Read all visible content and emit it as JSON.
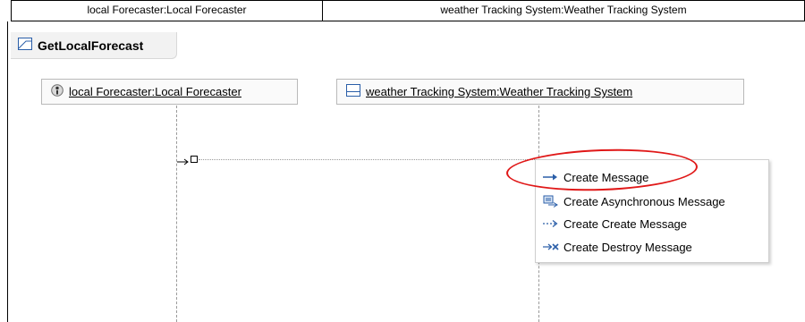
{
  "header": {
    "lifeline_a": "local Forecaster:Local Forecaster",
    "lifeline_b": "weather Tracking System:Weather Tracking System"
  },
  "interaction": {
    "title": "GetLocalForecast"
  },
  "lifelines": [
    {
      "label": "local Forecaster:Local Forecaster",
      "icon": "actor-icon"
    },
    {
      "label": "weather Tracking System:Weather Tracking System",
      "icon": "class-icon"
    }
  ],
  "context_menu": {
    "items": [
      {
        "label": "Create Message",
        "icon": "sync-message-arrow-icon"
      },
      {
        "label": "Create Asynchronous Message",
        "icon": "async-message-icon"
      },
      {
        "label": "Create Create Message",
        "icon": "create-message-dashed-arrow-icon"
      },
      {
        "label": "Create Destroy Message",
        "icon": "destroy-message-icon"
      }
    ],
    "highlighted_index": 0
  },
  "colors": {
    "highlight": "#e01818",
    "icon_blue": "#2a5ea8",
    "lifeline": "#9a9a9a"
  }
}
